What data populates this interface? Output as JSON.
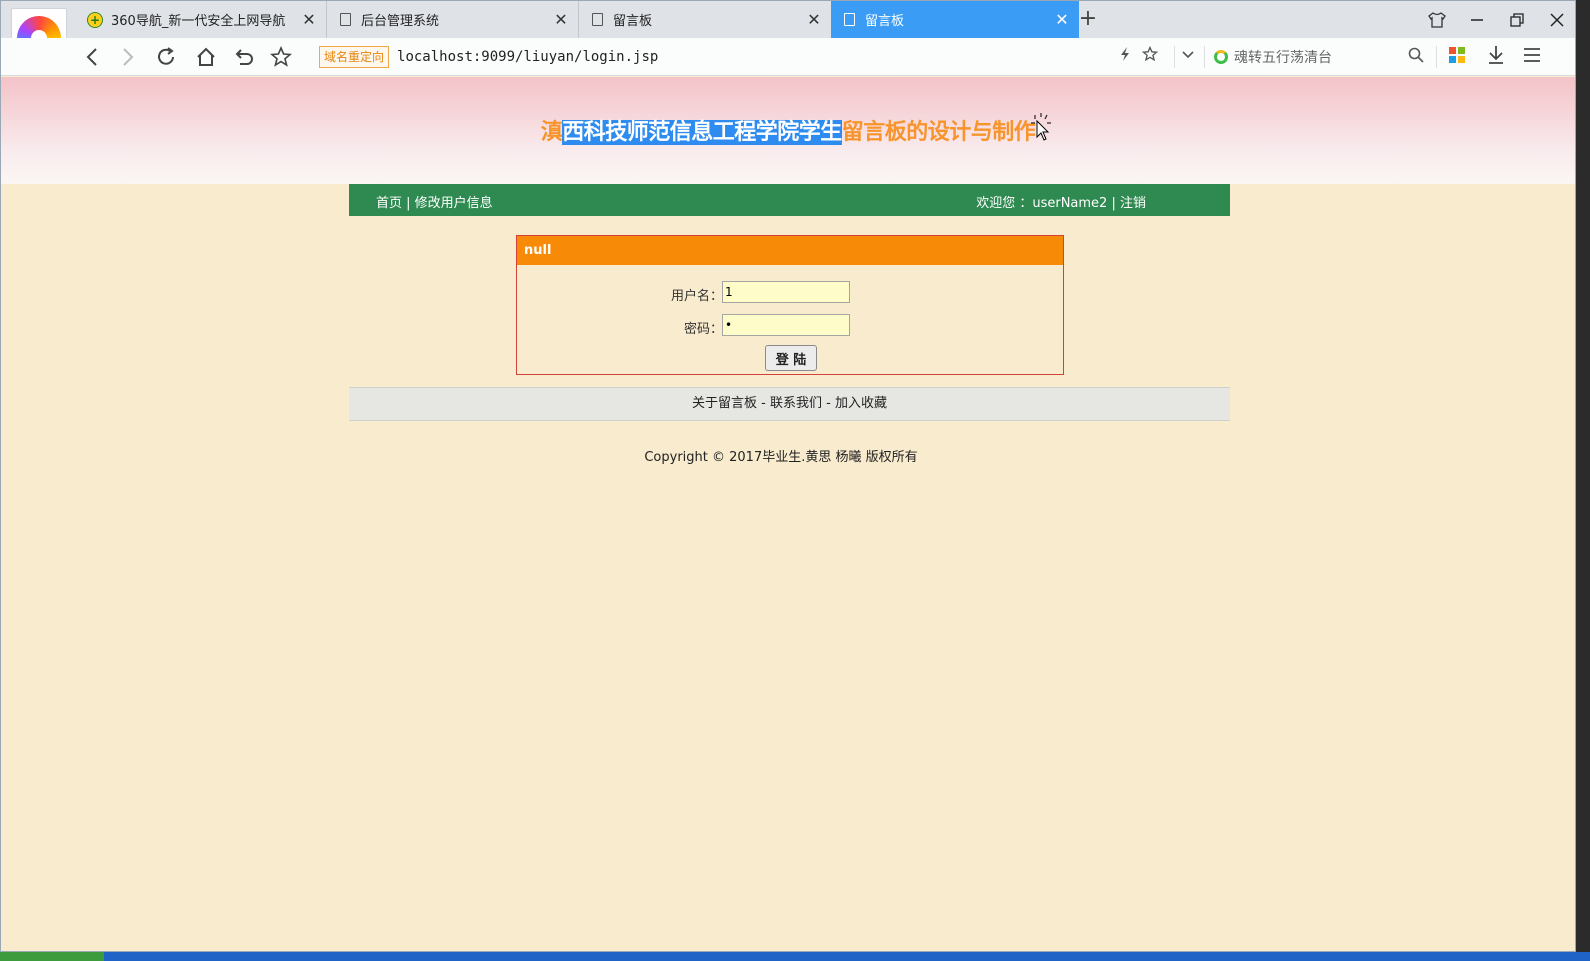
{
  "browser": {
    "tabs": [
      {
        "title": "360导航_新一代安全上网导航",
        "icon": "nav360-icon"
      },
      {
        "title": "后台管理系统",
        "icon": "page-icon"
      },
      {
        "title": "留言板",
        "icon": "page-icon"
      },
      {
        "title": "留言板",
        "icon": "page-icon",
        "active": true
      }
    ],
    "redirect_badge": "域名重定向",
    "url": "localhost:9099/liuyan/login.jsp",
    "search_text": "魂转五行荡清台",
    "accent": "#3b9cf5"
  },
  "page": {
    "title_prefix": "滇",
    "title_selected": "西科技师范信息工程学院学生",
    "title_suffix": "留言板的设计与制作",
    "title_color": "#f7942b",
    "nav": {
      "home": "首页",
      "sep1": " | ",
      "edit_user": "修改用户信息",
      "welcome": "欢迎您 ：userName2",
      "sep2": " | ",
      "logout": "注销",
      "bg": "#2f8a51"
    },
    "login": {
      "header": "null",
      "username_label": "用户名：",
      "username_value": "1",
      "password_label": "密码：",
      "password_value": "•",
      "submit_label": "登 陆",
      "header_bg": "#f78a06"
    },
    "footer": {
      "about": "关于留言板",
      "contact": "联系我们",
      "favorite": "加入收藏",
      "dash": " - ",
      "copyright": "Copyright © 2017毕业生.黄思 杨曦 版权所有"
    }
  }
}
